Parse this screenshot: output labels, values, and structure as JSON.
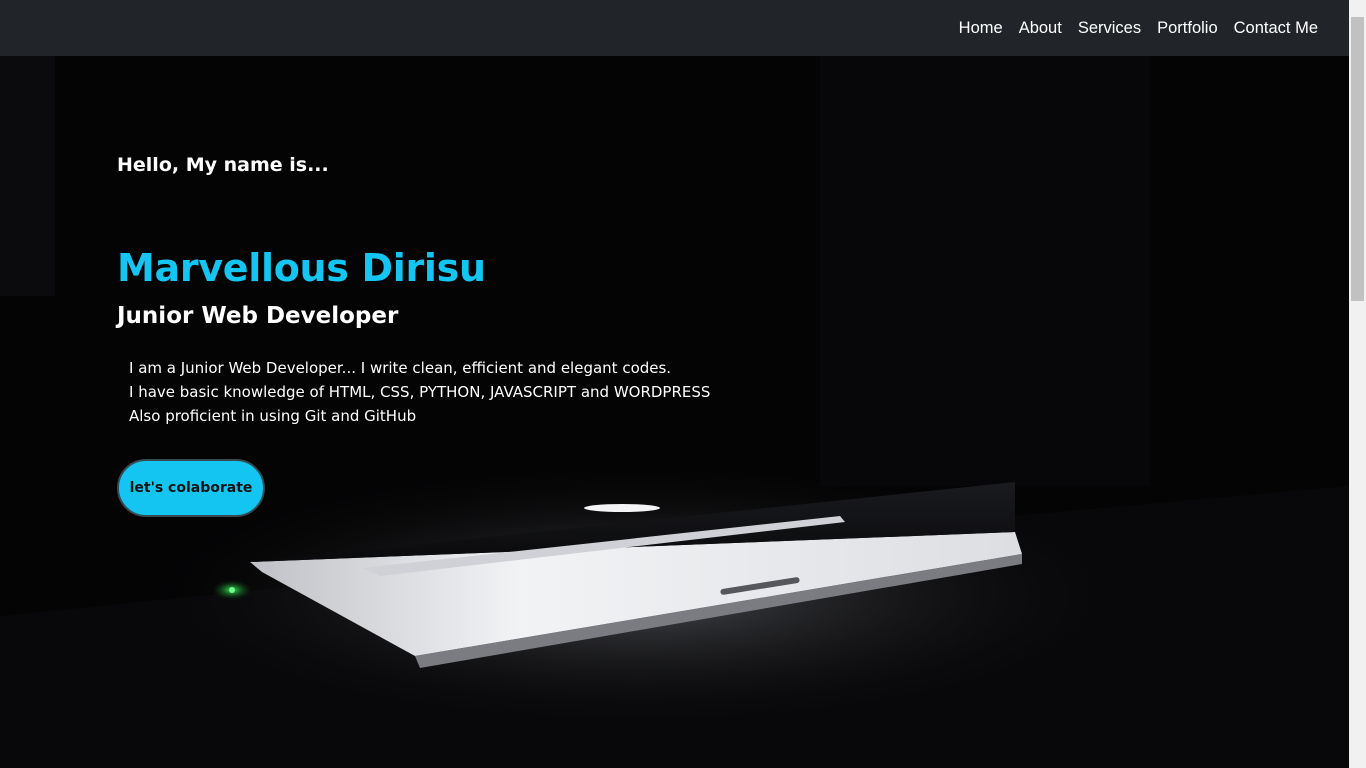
{
  "nav": {
    "links": [
      "Home",
      "About",
      "Services",
      "Portfolio",
      "Contact Me"
    ]
  },
  "hero": {
    "greeting": "Hello, My name is...",
    "name": "Marvellous Dirisu",
    "role": "Junior Web Developer",
    "bio": [
      "I am a Junior Web Developer... I write clean, efficient and elegant codes.",
      "I have basic knowledge of HTML, CSS, PYTHON, JAVASCRIPT and WORDPRESS",
      "Also proficient in using Git and GitHub"
    ],
    "cta_label": "let's colaborate"
  },
  "colors": {
    "navbar_bg": "#212529",
    "accent": "#13c5f0",
    "hero_bg": "#040405"
  },
  "images": {
    "hero_background": "laptop-glowing-in-dark-photo"
  }
}
